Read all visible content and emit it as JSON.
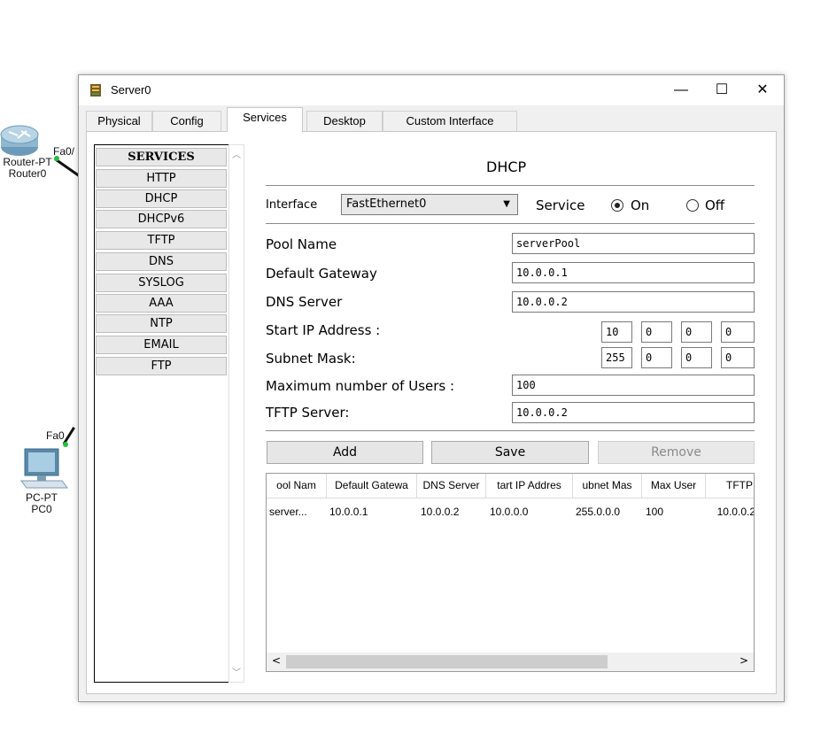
{
  "workspace": {
    "router": {
      "label1": "Router-PT",
      "label2": "Router0",
      "port": "Fa0/"
    },
    "pc": {
      "label1": "PC-PT",
      "label2": "PC0",
      "port": "Fa0"
    }
  },
  "window": {
    "title": "Server0",
    "minimize": "—",
    "maximize": "☐",
    "close": "✕"
  },
  "tabs": [
    {
      "label": "Physical",
      "active": false
    },
    {
      "label": "Config",
      "active": false
    },
    {
      "label": "Services",
      "active": true
    },
    {
      "label": "Desktop",
      "active": false
    },
    {
      "label": "Custom Interface",
      "active": false
    }
  ],
  "services": {
    "header": "SERVICES",
    "items": [
      "HTTP",
      "DHCP",
      "DHCPv6",
      "TFTP",
      "DNS",
      "SYSLOG",
      "AAA",
      "NTP",
      "EMAIL",
      "FTP"
    ]
  },
  "dhcp": {
    "title": "DHCP",
    "interface_label": "Interface",
    "interface_value": "FastEthernet0",
    "service_label": "Service",
    "on_label": "On",
    "off_label": "Off",
    "service_state": "On",
    "pool_name_label": "Pool Name",
    "pool_name_value": "serverPool",
    "gateway_label": "Default Gateway",
    "gateway_value": "10.0.0.1",
    "dns_label": "DNS Server",
    "dns_value": "10.0.0.2",
    "start_ip_label": "Start IP Address :",
    "start_ip": [
      "10",
      "0",
      "0",
      "0"
    ],
    "subnet_label": "Subnet Mask:",
    "subnet": [
      "255",
      "0",
      "0",
      "0"
    ],
    "max_users_label": "Maximum number of Users :",
    "max_users_value": "100",
    "tftp_label": "TFTP Server:",
    "tftp_value": "10.0.0.2",
    "add_label": "Add",
    "save_label": "Save",
    "remove_label": "Remove"
  },
  "pool_table": {
    "headers": [
      "ool Nam",
      "Default Gatewa",
      "DNS Server",
      "tart IP Addres",
      "ubnet Mas",
      "Max User",
      "TFTP"
    ],
    "rows": [
      [
        "server...",
        "10.0.0.1",
        "10.0.0.2",
        "10.0.0.0",
        "255.0.0.0",
        "100",
        "10.0.0.2"
      ]
    ],
    "scroll_left": "<",
    "scroll_right": ">"
  }
}
